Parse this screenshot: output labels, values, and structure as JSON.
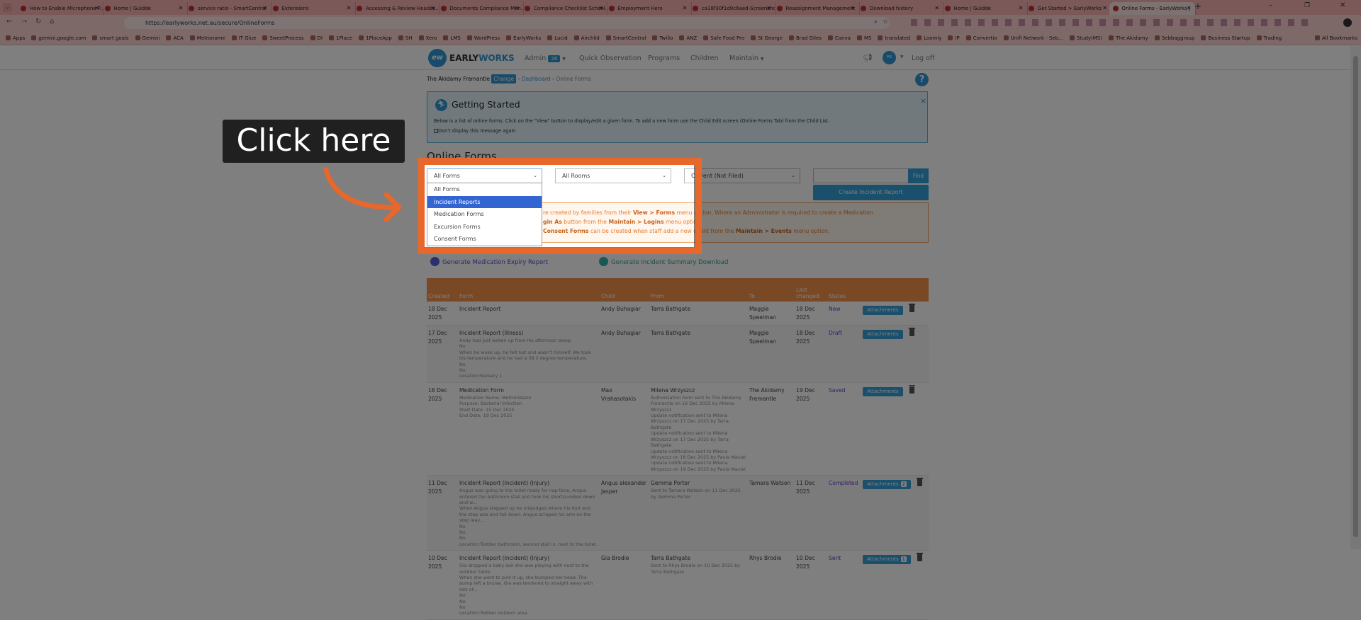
{
  "browser": {
    "tabs": [
      "How to Enable Microphone P...",
      "Home | Guidde",
      "service ratio - SmartCentral",
      "Extensions",
      "Accessing & Review Headco...",
      "Documents Compliance Mon...",
      "Compliance Checklist School...",
      "Employment Hero",
      "ca18f30f1d9c6aed-Screensho...",
      "Reassignment Management",
      "Download history",
      "Home | Guidde",
      "Get Started > EarlyWorks",
      "Online Forms - EarlyWorks |"
    ],
    "active_tab": 13,
    "url": "https://earlyworks.net.au/secure/OnlineForms",
    "bookmarks": [
      "Apps",
      "gemini.google.com",
      "smart goals",
      "Gemini",
      "ACA",
      "Metronome",
      "IT Glue",
      "SweetProcess",
      "DI",
      "1Place",
      "1PlaceApp",
      "SH",
      "Xero",
      "LMS",
      "WordPress",
      "EarlyWorks",
      "Lucid",
      "Airchild",
      "SmartCentral",
      "Twilio",
      "ANZ",
      "Safe Food Pro",
      "St George",
      "Brad Giles",
      "Canva",
      "MS",
      "translated",
      "Loomly",
      "IP",
      "Convertio",
      "Unifi Network - Seb...",
      "Study(MS)",
      "The Akidamy",
      "Sebbaggroup",
      "Business Startup",
      "Trading"
    ],
    "all_bookmarks": "All Bookmarks",
    "more": "»"
  },
  "nav": {
    "logo_mark": "ew",
    "logo_early": "EARLY",
    "logo_works": "WORKS",
    "admin": "Admin",
    "admin_badge": "26",
    "quick_observation": "Quick Observation",
    "programs": "Programs",
    "children": "Children",
    "maintain": "Maintain",
    "avatar": "MS",
    "logoff": "Log off"
  },
  "breadcrumb": {
    "centre": "The Akidamy Fremantle",
    "change": "Change",
    "dashboard": "Dashboard",
    "current": "Online Forms"
  },
  "help": "?",
  "getting_started": {
    "title": "Getting Started",
    "text": "Below is a list of online forms. Click on the \"View\" button to display/edit a given form. To add a new form use the Child Edit screen (Online Forms Tab) from the Child List.",
    "checkbox": "Don't display this message again",
    "close": "×"
  },
  "page_title": "Online Forms",
  "filters": {
    "forms_value": "All Forms",
    "forms_options": [
      "All Forms",
      "Incident Reports",
      "Medication Forms",
      "Excursion Forms",
      "Consent Forms"
    ],
    "highlighted_option": 1,
    "rooms_value": "All Rooms",
    "period_value": "Current (Not Filed)",
    "find": "Find",
    "create": "Create Incident Report"
  },
  "info": {
    "l1a": "re created by families from their ",
    "l1b": "View > Forms",
    "l1c": " menu option. Where an Administrator is required to create a Medication",
    "l2a": "gin As",
    "l2b": " button from the ",
    "l2c": "Maintain > Logins",
    "l2d": " menu option.",
    "l3a": "Consent Forms",
    "l3b": " can be created when staff add a new event from the ",
    "l3c": "Maintain > Events",
    "l3d": " menu option."
  },
  "links": {
    "medication": "Generate Medication Expiry Report",
    "incident": "Generate Incident Summary Download"
  },
  "table": {
    "headers": [
      "Created",
      "Form",
      "Child",
      "From",
      "To",
      "Last changed",
      "Status",
      ""
    ],
    "attach_label": "Attachments",
    "rows": [
      {
        "created": "18 Dec 2025",
        "form": "Incident Report",
        "details": [],
        "child": "Andy Buhagiar",
        "from": "Tarra Bathgate",
        "from_notes": [],
        "to": "Maggie Speelman",
        "changed": "18 Dec 2025",
        "status": "New",
        "attachments": ""
      },
      {
        "created": "17 Dec 2025",
        "form": "Incident Report (Illness)",
        "details": [
          "Andy had just woken up from his afternoon sleep.",
          "No",
          "When he woke up, he felt hot and wasn't himself. We took his temperature and he had a 38.2 degree temperature.",
          "No",
          "No",
          "Location:Nursery 1"
        ],
        "child": "Andy Buhagiar",
        "from": "Tarra Bathgate",
        "from_notes": [],
        "to": "Maggie Speelman",
        "changed": "18 Dec 2025",
        "status": "Draft",
        "attachments": ""
      },
      {
        "created": "16 Dec 2025",
        "form": "Medication Form",
        "details": [
          "Medication Name: Metronidazol",
          "Purpose: Bacterial Infection",
          "Start Date: 15 Dec 2025",
          "End Date: 19 Dec 2025"
        ],
        "child": "Max Vrahasotakis",
        "from": "Milena Wrzyszcz",
        "from_notes": [
          "Authorisation form sent to The Akidamy Fremantle on 16 Dec 2025 by Milena Wrzyszcz",
          "Update notification sent to Milena Wrzyszcz on 17 Dec 2025 by Tarra Bathgate",
          "Update notification sent to Milena Wrzyszcz on 17 Dec 2025 by Tarra Bathgate",
          "Update notification sent to Milena Wrzyszcz on 18 Dec 2025 by Paula Maciel",
          "Update notification sent to Milena Wrzyszcz on 19 Dec 2025 by Paula Maciel"
        ],
        "to": "The Akidamy Fremantle",
        "changed": "19 Dec 2025",
        "status": "Saved",
        "attachments": ""
      },
      {
        "created": "11 Dec 2025",
        "form": "Incident Report (Incident) (Injury)",
        "details": [
          "Angus was going to the toilet ready for nap time, Angus entered the bathroom stall and took his shorts/undies down and w...",
          "When Angus stepped up he misjudged where his foot and the step was and fell down. Angus scraped his arm on the step leav...",
          "No",
          "No",
          "No",
          "Location:Toddler bathroom, second stall in, next to the toilet."
        ],
        "child": "Angus alexander Jasper",
        "from": "Gemma Porter",
        "from_notes": [
          "Sent to Tamara Watson on 11 Dec 2025 by Gemma Porter"
        ],
        "to": "Tamara Watson",
        "changed": "11 Dec 2025",
        "status": "Completed",
        "attachments": "2"
      },
      {
        "created": "10 Dec 2025",
        "form": "Incident Report (Incident) (Injury)",
        "details": [
          "Gia dropped a baby doll she was playing with next to the outdoor table.",
          "When she went to pick it up, she bumped her head. The bump left a bruise. Gia was tendered to straight away with lots of...",
          "No",
          "No",
          "No",
          "Location:Toddler outdoor area"
        ],
        "child": "Gia Brodie",
        "from": "Tarra Bathgate",
        "from_notes": [
          "Sent to Rhys Brodie on 10 Dec 2025 by Tarra Bathgate"
        ],
        "to": "Rhys Brodie",
        "changed": "10 Dec 2025",
        "status": "Sent",
        "attachments": "1"
      }
    ]
  },
  "annotation": {
    "label": "Click here"
  },
  "colors": {
    "accent": "#2e96d3",
    "highlight": "#e8672a",
    "table_header": "#f2914b",
    "status": "#6a3fd0"
  }
}
